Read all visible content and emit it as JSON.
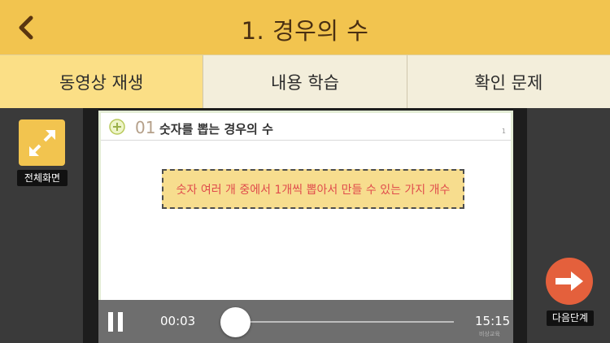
{
  "header": {
    "title": "1. 경우의 수",
    "back_icon": "chevron-left-icon",
    "background": "#f2c44f"
  },
  "tabs": [
    {
      "label": "동영상 재생",
      "active": true
    },
    {
      "label": "내용 학습",
      "active": false
    },
    {
      "label": "확인 문제",
      "active": false
    }
  ],
  "sidebar": {
    "fullscreen_label": "전체화면",
    "fullscreen_icon": "expand-arrows-icon"
  },
  "slide": {
    "number": "01",
    "title": "숫자를 뽑는 경우의 수",
    "page": "1",
    "concept": "숫자 여러 개 중에서 1개씩 뽑아서 만들 수 있는 가지 개수"
  },
  "player": {
    "current_time": "00:03",
    "total_time": "15:15",
    "progress": 0.04,
    "watermark": "비상교육"
  },
  "next": {
    "label": "다음단계",
    "icon": "arrow-right-icon",
    "color": "#e4603c"
  }
}
